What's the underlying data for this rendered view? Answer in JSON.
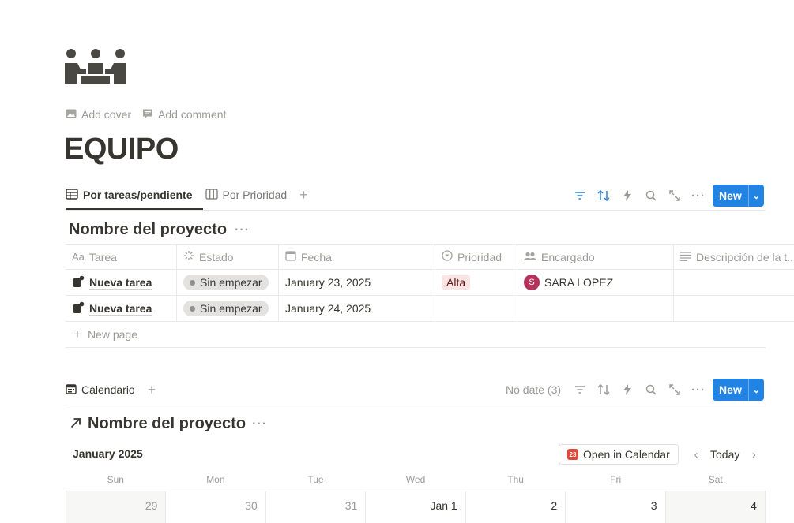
{
  "page": {
    "icon": "team-meeting-icon",
    "actions": [
      {
        "icon": "image-icon",
        "label": "Add cover"
      },
      {
        "icon": "comment-icon",
        "label": "Add comment"
      }
    ],
    "title": "EQUIPO"
  },
  "table_view": {
    "tabs": [
      {
        "icon": "table-icon",
        "label": "Por tareas/pendiente",
        "active": true
      },
      {
        "icon": "board-icon",
        "label": "Por Prioridad",
        "active": false
      }
    ],
    "toolbar": {
      "new_label": "New"
    },
    "database_title": "Nombre del proyecto",
    "columns": [
      {
        "icon": "Aa",
        "label": "Tarea"
      },
      {
        "icon": "status-icon",
        "label": "Estado"
      },
      {
        "icon": "calendar-icon",
        "label": "Fecha"
      },
      {
        "icon": "select-icon",
        "label": "Prioridad"
      },
      {
        "icon": "people-icon",
        "label": "Encargado"
      },
      {
        "icon": "text-icon",
        "label": "Descripción de la t..."
      }
    ],
    "rows": [
      {
        "task": "Nueva tarea",
        "status": "Sin empezar",
        "date": "January 23, 2025",
        "priority": "Alta",
        "assignee_initial": "S",
        "assignee": "SARA LOPEZ",
        "description": ""
      },
      {
        "task": "Nueva tarea",
        "status": "Sin empezar",
        "date": "January 24, 2025",
        "priority": "",
        "assignee_initial": "",
        "assignee": "",
        "description": ""
      }
    ],
    "new_page_label": "New page"
  },
  "calendar_view": {
    "tab": {
      "icon": "calendar-icon",
      "label": "Calendario"
    },
    "no_date_label": "No date (3)",
    "new_label": "New",
    "database_title": "Nombre del proyecto",
    "month": "January 2025",
    "open_in_calendar": {
      "badge": "23",
      "label": "Open in Calendar"
    },
    "today_label": "Today",
    "weekdays": [
      "Sun",
      "Mon",
      "Tue",
      "Wed",
      "Thu",
      "Fri",
      "Sat"
    ],
    "days": [
      "29",
      "30",
      "31",
      "Jan 1",
      "2",
      "3",
      "4"
    ]
  },
  "colors": {
    "accent": "#2383e2",
    "text": "#37352f",
    "muted": "#9b9a97",
    "priority_high_bg": "#fbe4e4",
    "avatar": "#b4325a"
  }
}
